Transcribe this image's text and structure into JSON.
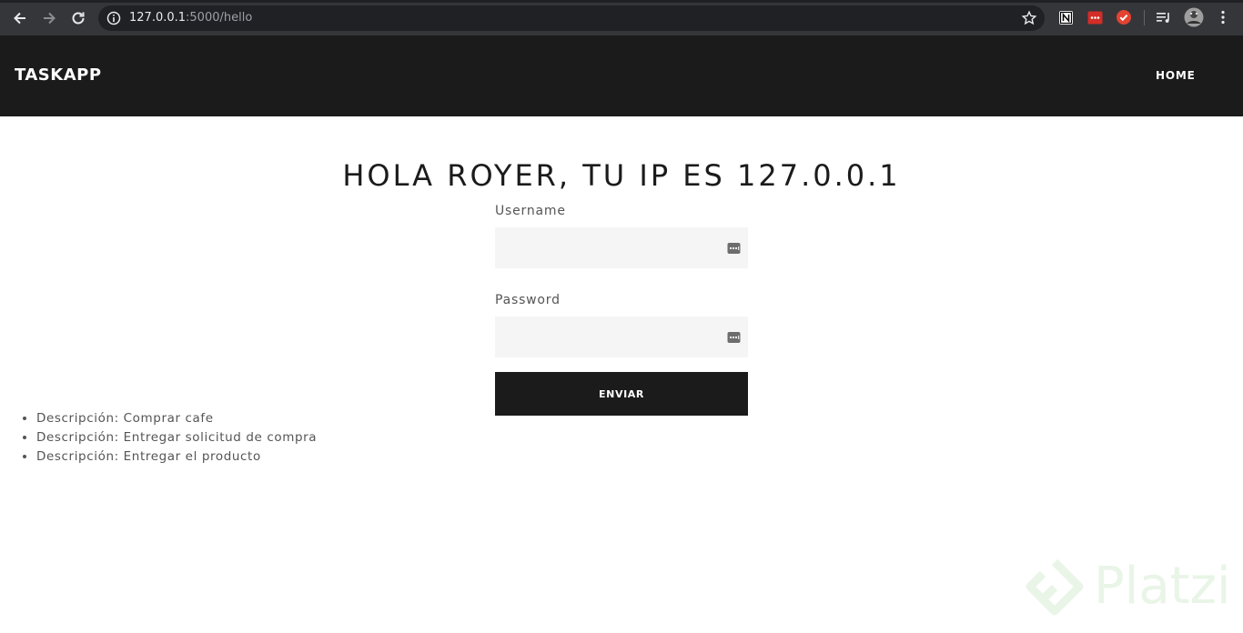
{
  "browser": {
    "url_host": "127.0.0.1",
    "url_rest": ":5000/hello",
    "icons": [
      "back-arrow-icon",
      "forward-arrow-icon",
      "reload-icon",
      "info-icon",
      "star-icon",
      "notion-extension-icon",
      "lastpass-extension-icon",
      "todoist-extension-icon",
      "media-queue-icon",
      "profile-avatar-icon",
      "menu-kebab-icon"
    ]
  },
  "navbar": {
    "brand": "TASKAPP",
    "home_label": "HOME"
  },
  "main": {
    "heading": "HOLA ROYER, TU IP ES 127.0.0.1",
    "form": {
      "username_label": "Username",
      "username_value": "",
      "password_label": "Password",
      "password_value": "",
      "submit_label": "ENVIAR"
    },
    "tasks": [
      "Descripción: Comprar cafe",
      "Descripción: Entregar solicitud de compra",
      "Descripción: Entregar el producto"
    ]
  },
  "watermark": {
    "text": "Platzi"
  },
  "colors": {
    "navbar_bg": "#1b1b1b",
    "button_bg": "#1b1b1b",
    "field_bg": "#f5f5f6",
    "watermark": "#e9f5e7"
  }
}
